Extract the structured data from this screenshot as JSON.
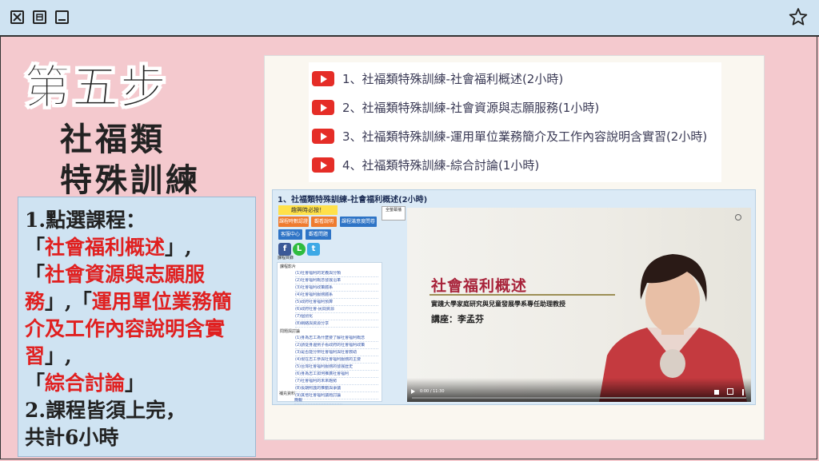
{
  "window": {
    "close_icon": "close-box-icon",
    "restore_icon": "restore-icon",
    "minimize_icon": "minimize-icon",
    "star_icon": "star-icon"
  },
  "headings": {
    "step": "第五步",
    "category": "社福類",
    "training": "特殊訓練"
  },
  "instructions": {
    "line1": "1.點選課程：",
    "q1o": "「",
    "c1": "社會福利概述",
    "q1c": "」,",
    "q2o": "「",
    "c2": "社會資源與志願服務",
    "q2c": "」,",
    "q3o": "「",
    "c3": "運用單位業務簡介及工作內容說明含實習",
    "q3c": "」,",
    "q4o": "「",
    "c4": "綜合討論",
    "q4c": "」",
    "line2": "2.課程皆須上完，",
    "line3": "共計6小時",
    "highlight_color": "#e02020"
  },
  "courses": [
    {
      "label": "1、社福類特殊訓練-社會福利概述(2小時)"
    },
    {
      "label": "2、社福類特殊訓練-社會資源與志願服務(1小時)"
    },
    {
      "label": "3、社福類特殊訓練-運用單位業務簡介及工作內容說明含實習(2小時)"
    },
    {
      "label": "4、社福類特殊訓練-綜合討論(1小時)"
    }
  ],
  "page": {
    "title": "1、社福類特殊訓練-社會福利概述(2小時)",
    "notice": "趣興時必按！",
    "buttons": [
      "課程時數認證",
      "觀看說明",
      "課程滿意度問卷",
      "客服中心",
      "觀看問題"
    ],
    "full_screen": "全螢幕播",
    "tree_header": "課程目錄",
    "tree_groups": [
      "課程影片",
      "問題與討論",
      "補充資料"
    ],
    "tree_items_1": [
      "(1)社會福利的定義與分類",
      "(2)社會福利概念發展沿革",
      "(3)社會福利政策體系",
      "(4)社會福利服務體系",
      "(5)政府社會福利預算",
      "(6)政府社會-民間資源",
      "(7)個別化",
      "(8)網絡與資源分享"
    ],
    "tree_items_2": [
      "(1)身為志工為什麼要了解社會福利概念",
      "(2)請從身邊例子看政府的社會福利政策",
      "(3)是否能分辨社會福利與社會救助",
      "(4)現在志工參與社會福利服務的主要",
      "(5)台灣社會福利服務的發展歷史",
      "(6)身為志工如何推廣社會福利",
      "(7)社會福利的未來趨勢",
      "(8)長期照護的推動與爭議",
      "(9)其他社會福利議題討論"
    ],
    "tree_items_3": [
      "簡報"
    ]
  },
  "video": {
    "title": "社會福利概述",
    "subtitle": "實踐大學家庭研究與兒童發展學系專任助理教授",
    "lecturer": "講座：李孟芬",
    "time": "0:00 / 11:30"
  }
}
